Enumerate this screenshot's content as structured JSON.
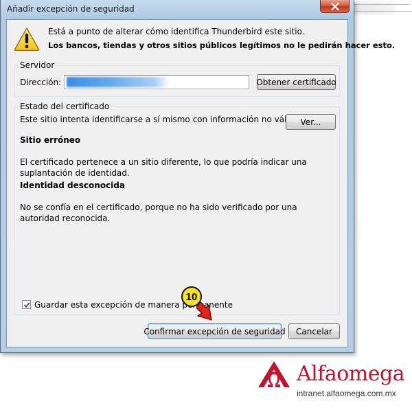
{
  "window": {
    "title": "Añadir excepción de seguridad"
  },
  "warning": {
    "line1": "Está a punto de alterar cómo identifica Thunderbird este sitio.",
    "line2": "Los bancos, tiendas y otros sitios públicos legítimos no le pedirán hacer esto."
  },
  "server": {
    "group_title": "Servidor",
    "address_label": "Dirección:",
    "address_value": "",
    "get_cert_button": "Obtener certificado"
  },
  "cert_status": {
    "group_title": "Estado del certificado",
    "intro": "Este sitio intenta identificarse a sí mismo con información no válida.",
    "view_button": "Ver...",
    "wrong_site_heading": "Sitio erróneo",
    "wrong_site_text": "El certificado pertenece a un sitio diferente, lo que podría indicar una suplantación de identidad.",
    "unknown_identity_heading": "Identidad desconocida",
    "unknown_identity_text": "No se confía en el certificado, porque no ha sido verificado por una autoridad reconocida."
  },
  "permanent_checkbox": {
    "label": "Guardar esta excepción de manera permanente",
    "checked": true
  },
  "actions": {
    "confirm_button": "Confirmar excepción de seguridad",
    "cancel_button": "Cancelar"
  },
  "annotation": {
    "step_number": "10"
  },
  "branding": {
    "name": "Alfaomega",
    "url": "intranet.alfaomega.com.mx"
  },
  "colors": {
    "brand_red": "#c8102e",
    "badge_yellow": "#f5e21b",
    "warning_yellow": "#f2c418"
  },
  "icons": [
    "warning-icon",
    "close-icon",
    "check-icon",
    "arrow-pointer-icon",
    "alfaomega-logo-icon"
  ]
}
